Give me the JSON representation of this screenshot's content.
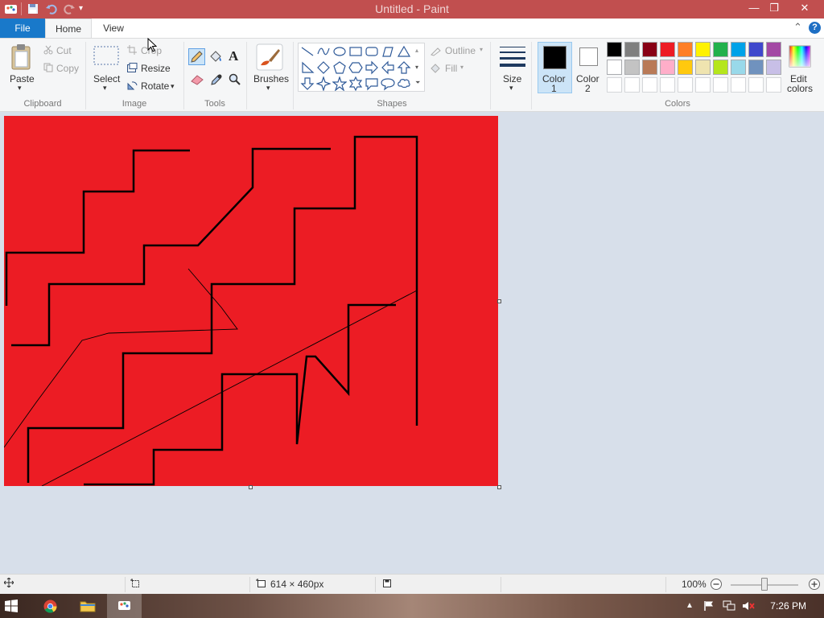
{
  "window": {
    "title": "Untitled - Paint",
    "controls": {
      "minimize": "—",
      "restore": "❐",
      "close": "✕"
    }
  },
  "tabs": {
    "file": "File",
    "home": "Home",
    "view": "View",
    "help": "?"
  },
  "ribbon": {
    "clipboard": {
      "paste": "Paste",
      "cut": "Cut",
      "copy": "Copy",
      "group": "Clipboard"
    },
    "image": {
      "select": "Select",
      "crop": "Crop",
      "resize": "Resize",
      "rotate": "Rotate",
      "group": "Image"
    },
    "tools": {
      "group": "Tools",
      "active_tool": "pencil"
    },
    "brushes": {
      "label": "Brushes"
    },
    "shapes": {
      "outline": "Outline",
      "fill": "Fill",
      "group": "Shapes"
    },
    "size": {
      "label": "Size"
    },
    "colors": {
      "color1_label": "Color\n1",
      "color1_line1": "Color",
      "color1_line2": "1",
      "color2_line1": "Color",
      "color2_line2": "2",
      "color1_value": "#000000",
      "color2_value": "#ffffff",
      "edit": "Edit\ncolors",
      "edit_line1": "Edit",
      "edit_line2": "colors",
      "group": "Colors",
      "palette_row1": [
        "#000000",
        "#7f7f7f",
        "#880015",
        "#ed1c24",
        "#ff7f27",
        "#fff200",
        "#22b14c",
        "#00a2e8",
        "#3f48cc",
        "#a349a4"
      ],
      "palette_row2": [
        "#ffffff",
        "#c3c3c3",
        "#b97a57",
        "#ffaec9",
        "#ffc90e",
        "#efe4b0",
        "#b5e61d",
        "#99d9ea",
        "#7092be",
        "#c8bfe7"
      ]
    }
  },
  "canvas": {
    "background": "#ec1c24",
    "stroke": "#000000"
  },
  "statusbar": {
    "dimensions": "614 × 460px",
    "zoom": "100%"
  },
  "taskbar": {
    "time": "7:26 PM"
  }
}
